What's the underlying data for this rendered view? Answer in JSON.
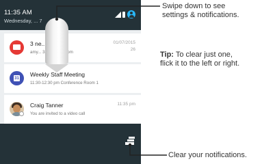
{
  "statusbar": {
    "time": "11:35 AM",
    "date": "Wednesday, ... 7"
  },
  "notifications": [
    {
      "app": "gmail",
      "title": "3 ne... sages",
      "subtitle": "amy... 321@gmail.com",
      "meta": "01/07/2015",
      "meta2": "26"
    },
    {
      "app": "calendar",
      "calendar_day": "31",
      "title": "Weekly Staff Meeting",
      "subtitle": "11:30-12:30 pm Conference Room 1",
      "meta": ""
    },
    {
      "app": "hangouts",
      "title": "Craig Tanner",
      "subtitle": "You are invited to a video call",
      "meta": "11:35 pm"
    }
  ],
  "callouts": {
    "swipe": {
      "line1": "Swipe down to see",
      "line2": "settings & notifications."
    },
    "tip": {
      "label": "Tip:",
      "line1_rest": " To clear just one,",
      "line2": "flick it to the left or right."
    },
    "clear": "Clear your notifications."
  },
  "icons": {
    "signal": "signal-icon",
    "battery": "battery-icon",
    "account": "account-icon",
    "gmail": "gmail-icon",
    "calendar": "calendar-icon",
    "avatar": "avatar",
    "video": "video-call-icon",
    "swipe_gesture": "swipe-down-gesture",
    "clear_all": "clear-all-icon"
  },
  "colors": {
    "statusbar_bg": "#243238",
    "panel_bg": "#eceff1",
    "gmail": "#e53935",
    "calendar": "#3f51b5",
    "account": "#29b6f6",
    "callout_line": "#222222"
  }
}
